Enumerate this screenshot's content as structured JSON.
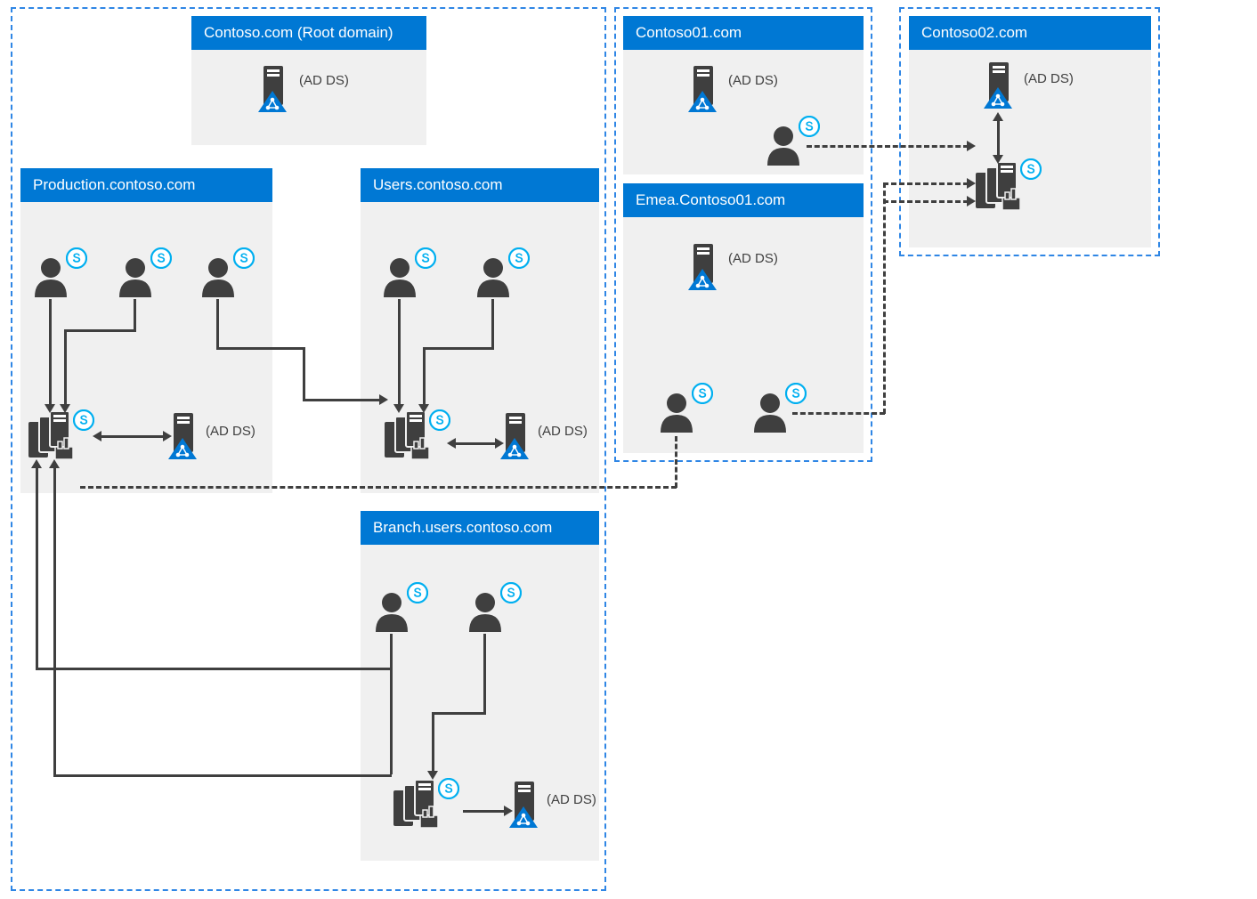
{
  "colors": {
    "header": "#0078d4",
    "border": "#2f86e5",
    "icon_dark": "#3f3f3f",
    "skype": "#00aff0",
    "ad_blue": "#0078d4"
  },
  "ad_label": "(AD DS)",
  "forests": {
    "contoso": {
      "root": "Contoso.com (Root domain)",
      "children": [
        "Production.contoso.com",
        "Users.contoso.com",
        "Branch.users.contoso.com"
      ]
    },
    "contoso01": {
      "root": "Contoso01.com",
      "children": [
        "Emea.Contoso01.com"
      ]
    },
    "contoso02": {
      "root": "Contoso02.com",
      "children": []
    }
  },
  "domains": {
    "root": {
      "title": "Contoso.com (Root domain)",
      "ad_ds": true,
      "users": 0,
      "pool": false
    },
    "production": {
      "title": "Production.contoso.com",
      "ad_ds": true,
      "users": 3,
      "pool": true
    },
    "users": {
      "title": "Users.contoso.com",
      "ad_ds": true,
      "users": 2,
      "pool": true
    },
    "branch": {
      "title": "Branch.users.contoso.com",
      "ad_ds": true,
      "users": 2,
      "pool": true
    },
    "contoso01": {
      "title": "Contoso01.com",
      "ad_ds": true,
      "users": 1,
      "pool": false
    },
    "emea": {
      "title": "Emea.Contoso01.com",
      "ad_ds": true,
      "users": 2,
      "pool": false
    },
    "contoso02": {
      "title": "Contoso02.com",
      "ad_ds": true,
      "users": 0,
      "pool": true
    }
  },
  "connections": [
    {
      "from": "production.users",
      "to": "production.pool",
      "style": "solid"
    },
    {
      "from": "production.users",
      "to": "users.pool",
      "style": "solid"
    },
    {
      "from": "users.users",
      "to": "users.pool",
      "style": "solid"
    },
    {
      "from": "branch.users",
      "to": "branch.pool",
      "style": "solid"
    },
    {
      "from": "branch.users",
      "to": "production.pool",
      "style": "solid"
    },
    {
      "from": "production.pool",
      "to": "production.adds",
      "style": "solid-bidir"
    },
    {
      "from": "users.pool",
      "to": "users.adds",
      "style": "solid-bidir"
    },
    {
      "from": "branch.pool",
      "to": "branch.adds",
      "style": "solid-bidir"
    },
    {
      "from": "contoso02.pool",
      "to": "contoso02.adds",
      "style": "solid-bidir"
    },
    {
      "from": "contoso01.users",
      "to": "contoso02.pool",
      "style": "dashed"
    },
    {
      "from": "emea.users",
      "to": "contoso02.pool",
      "style": "dashed"
    },
    {
      "from": "emea.users",
      "to": "users.pool",
      "style": "dashed"
    }
  ]
}
